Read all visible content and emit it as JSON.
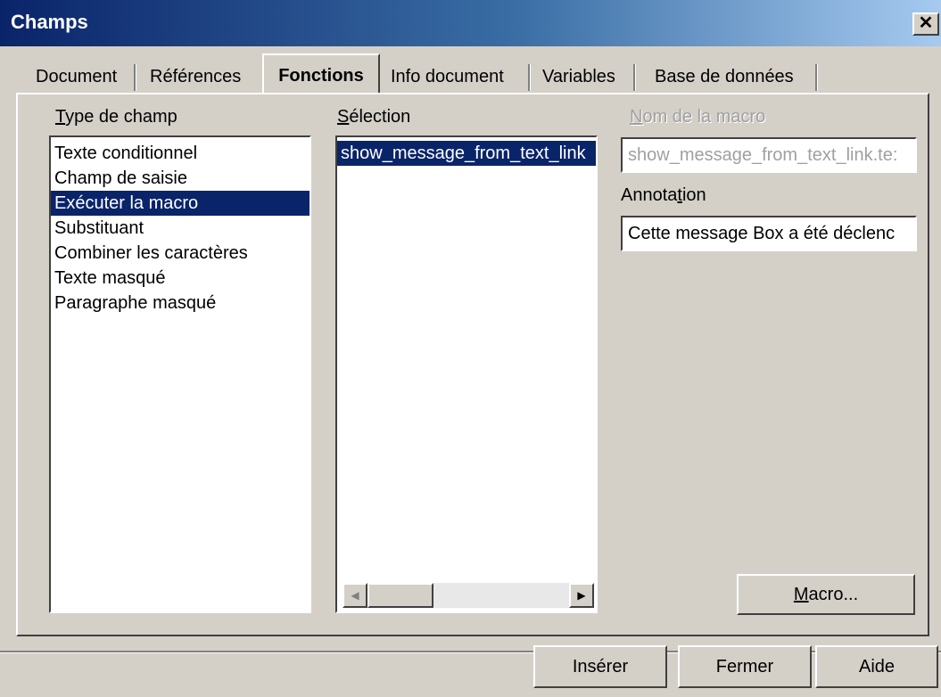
{
  "window": {
    "title": "Champs",
    "close_glyph": "✕"
  },
  "tabs": [
    {
      "label": "Document",
      "active": false
    },
    {
      "label": "Références",
      "active": false
    },
    {
      "label": "Fonctions",
      "active": true
    },
    {
      "label": "Info document",
      "active": false
    },
    {
      "label": "Variables",
      "active": false
    },
    {
      "label": "Base de données",
      "active": false
    }
  ],
  "type_champ": {
    "label_first": "T",
    "label_rest": "ype de champ",
    "items": [
      "Texte conditionnel",
      "Champ de saisie",
      "Exécuter la macro",
      "Substituant",
      "Combiner les caractères",
      "Texte masqué",
      "Paragraphe masqué"
    ],
    "selected_index": 2
  },
  "selection": {
    "label_first": "S",
    "label_rest": "élection",
    "items": [
      "show_message_from_text_link"
    ],
    "selected_index": 0
  },
  "macro_name": {
    "label_first": "N",
    "label_rest": "om de la macro",
    "value": "show_message_from_text_link.te:"
  },
  "annotation": {
    "label_pre": "Annota",
    "label_u": "t",
    "label_post": "ion",
    "value": "Cette message Box a été déclenc"
  },
  "buttons": {
    "macro_first": "M",
    "macro_rest": "acro...",
    "insert": "Insérer",
    "close": "Fermer",
    "help": "Aide"
  },
  "icons": {
    "scroll_left": "◀",
    "scroll_right": "▶"
  }
}
